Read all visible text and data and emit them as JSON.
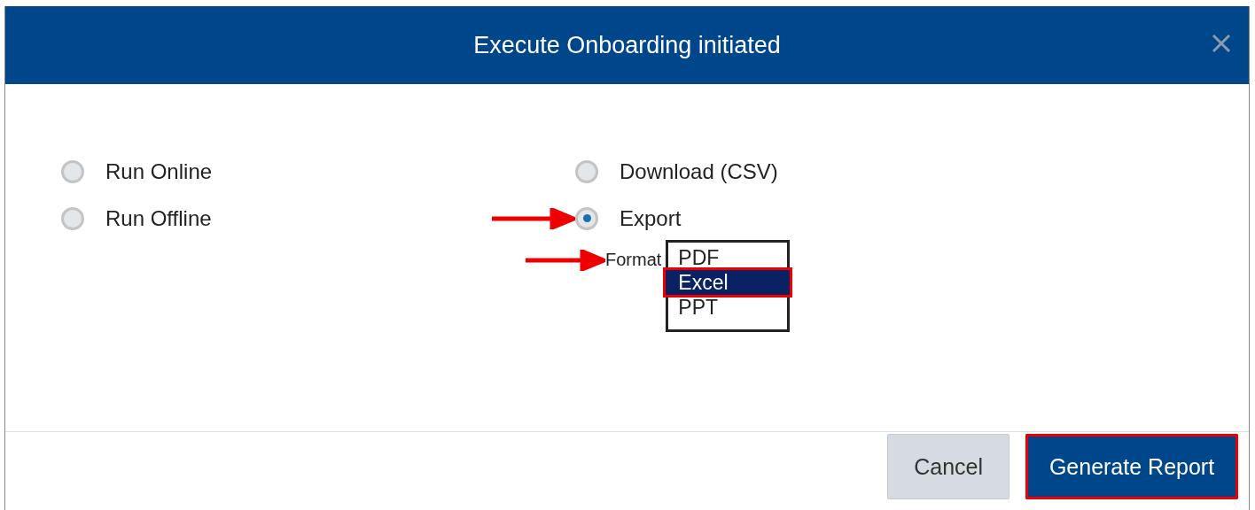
{
  "dialog": {
    "title": "Execute Onboarding initiated"
  },
  "options_left": [
    {
      "label": "Run Online",
      "selected": false,
      "arrow": false
    },
    {
      "label": "Run Offline",
      "selected": false,
      "arrow": false
    }
  ],
  "options_right": [
    {
      "label": "Download (CSV)",
      "selected": false,
      "arrow": false
    },
    {
      "label": "Export",
      "selected": true,
      "arrow": true
    }
  ],
  "format": {
    "label": "Format",
    "arrow": true,
    "options": [
      {
        "label": "PDF",
        "selected": false,
        "highlighted": false
      },
      {
        "label": "Excel",
        "selected": true,
        "highlighted": true
      },
      {
        "label": "PPT",
        "selected": false,
        "highlighted": false
      }
    ]
  },
  "buttons": [
    {
      "label": "Cancel",
      "kind": "secondary",
      "highlighted": false
    },
    {
      "label": "Generate Report",
      "kind": "primary",
      "highlighted": true
    }
  ]
}
